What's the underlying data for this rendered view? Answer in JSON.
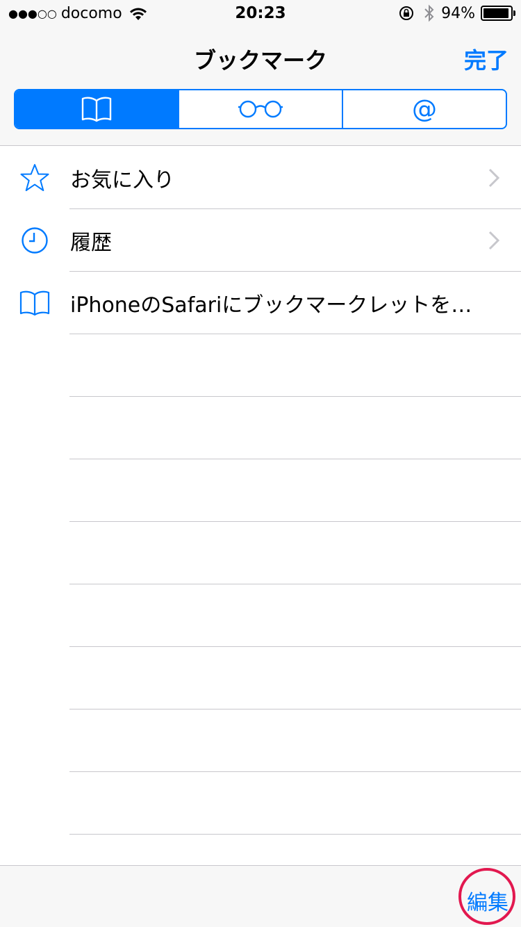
{
  "status_bar": {
    "signal": "●●●○○",
    "carrier": "docomo",
    "time": "20:23",
    "battery_percent": "94%",
    "battery_level": 0.94
  },
  "nav": {
    "title": "ブックマーク",
    "done_label": "完了"
  },
  "segments": [
    {
      "icon": "book-icon",
      "selected": true
    },
    {
      "icon": "glasses-icon",
      "selected": false
    },
    {
      "icon": "at-icon",
      "label": "@",
      "selected": false
    }
  ],
  "list": {
    "items": [
      {
        "icon": "star-icon",
        "label": "お気に入り",
        "has_chevron": true
      },
      {
        "icon": "clock-icon",
        "label": "履歴",
        "has_chevron": true
      },
      {
        "icon": "book-icon",
        "label": "iPhoneのSafariにブックマークレットを…",
        "has_chevron": false
      }
    ]
  },
  "toolbar": {
    "edit_label": "編集"
  },
  "colors": {
    "accent": "#007aff",
    "highlight_circle": "#e2184f"
  }
}
